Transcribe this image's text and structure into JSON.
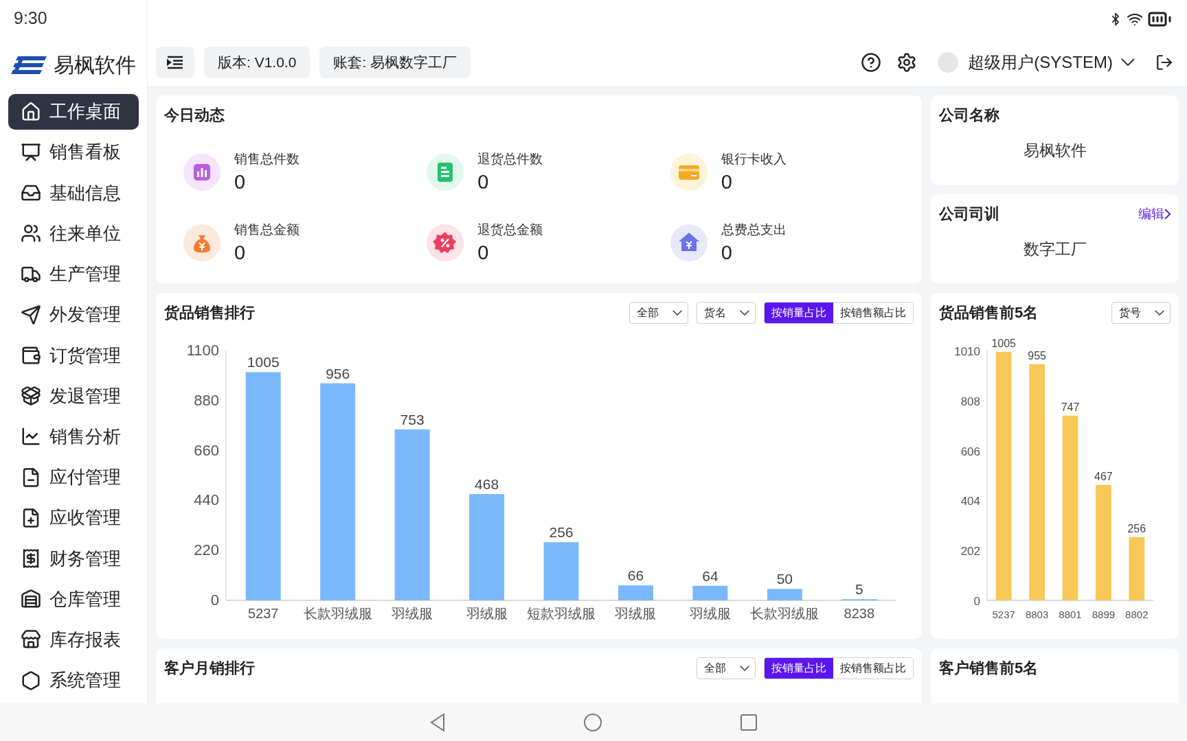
{
  "status_bar": {
    "time": "9:30"
  },
  "sidebar": {
    "logo": "易枫软件",
    "items": [
      {
        "label": "工作桌面",
        "selected": true
      },
      {
        "label": "销售看板",
        "selected": false
      },
      {
        "label": "基础信息",
        "selected": false
      },
      {
        "label": "往来单位",
        "selected": false
      },
      {
        "label": "生产管理",
        "selected": false
      },
      {
        "label": "外发管理",
        "selected": false
      },
      {
        "label": "订货管理",
        "selected": false
      },
      {
        "label": "发退管理",
        "selected": false
      },
      {
        "label": "销售分析",
        "selected": false
      },
      {
        "label": "应付管理",
        "selected": false
      },
      {
        "label": "应收管理",
        "selected": false
      },
      {
        "label": "财务管理",
        "selected": false
      },
      {
        "label": "仓库管理",
        "selected": false
      },
      {
        "label": "库存报表",
        "selected": false
      },
      {
        "label": "系统管理",
        "selected": false
      }
    ]
  },
  "header": {
    "version": "版本: V1.0.0",
    "account": "账套: 易枫数字工厂",
    "user": "超级用户(SYSTEM)"
  },
  "today": {
    "title": "今日动态",
    "stats": [
      {
        "kind": "chart",
        "label": "销售总件数",
        "value": "0"
      },
      {
        "kind": "document",
        "label": "退货总件数",
        "value": "0"
      },
      {
        "kind": "card",
        "label": "银行卡收入",
        "value": "0"
      },
      {
        "kind": "moneybag",
        "label": "销售总金额",
        "value": "0"
      },
      {
        "kind": "percent",
        "label": "退货总金额",
        "value": "0"
      },
      {
        "kind": "house",
        "label": "总费总支出",
        "value": "0"
      }
    ]
  },
  "company_name": {
    "title": "公司名称",
    "value": "易枫软件"
  },
  "motto": {
    "title": "公司司训",
    "edit": "编辑",
    "value": "数字工厂"
  },
  "goods_ranking": {
    "title": "货品销售排行",
    "filters": [
      "全部",
      "货名"
    ],
    "toggles": [
      {
        "label": "按销量占比",
        "selected": true
      },
      {
        "label": "按销售额占比",
        "selected": false
      }
    ],
    "chart_data": {
      "type": "bar",
      "categories": [
        "5237",
        "长款羽绒服",
        "羽绒服",
        "羽绒服",
        "短款羽绒服",
        "羽绒服",
        "羽绒服",
        "长款羽绒服",
        "8238"
      ],
      "series": [
        {
          "color": "#7ab8fb",
          "values": [
            1005,
            956,
            753,
            468,
            256,
            66,
            64,
            50,
            5
          ]
        }
      ],
      "ylim": [
        0,
        1100
      ],
      "yticks": [
        0,
        220,
        440,
        660,
        880,
        1100
      ],
      "data_labels": true
    }
  },
  "top5_goods": {
    "title": "货品销售前5名",
    "filter": "货号",
    "chart_data": {
      "type": "bar",
      "categories": [
        "5237",
        "8803",
        "8801",
        "8899",
        "8802"
      ],
      "series": [
        {
          "color": "#f7c758",
          "values": [
            1005,
            955,
            747,
            467,
            256
          ]
        }
      ],
      "ylim": [
        0,
        1010
      ],
      "yticks": [
        0,
        202,
        404,
        606,
        808,
        1010
      ],
      "data_labels": true
    }
  },
  "customer_ranking": {
    "title": "客户月销排行",
    "filters": [
      "全部"
    ],
    "toggles": [
      {
        "label": "按销量占比",
        "selected": true
      },
      {
        "label": "按销售额占比",
        "selected": false
      }
    ]
  },
  "top5_customers": {
    "title": "客户销售前5名"
  }
}
